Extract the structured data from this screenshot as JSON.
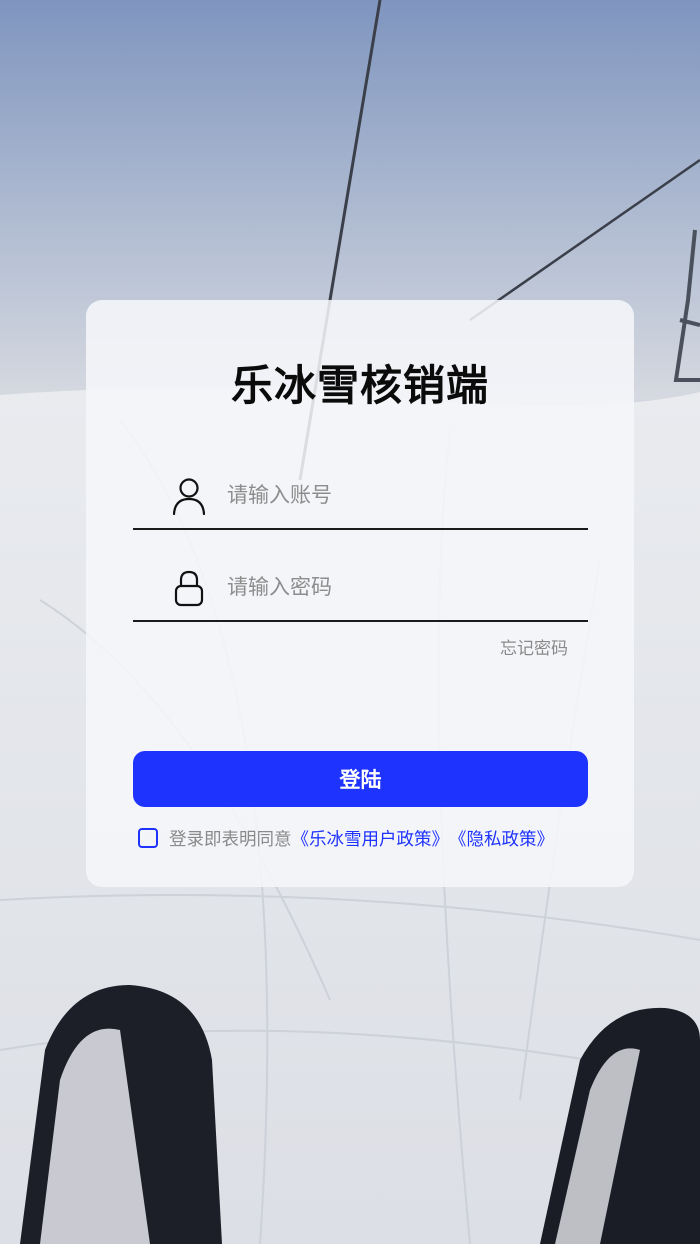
{
  "app": {
    "title": "乐冰雪核销端"
  },
  "form": {
    "account_placeholder": "请输入账号",
    "password_placeholder": "请输入密码",
    "forgot_label": "忘记密码",
    "login_label": "登陆"
  },
  "agreement": {
    "checked": false,
    "prefix": "登录即表明同意",
    "user_policy": "《乐冰雪用户政策》",
    "privacy_policy": "《隐私政策》"
  },
  "colors": {
    "accent": "#1f33ff",
    "placeholder": "#8d8d8d"
  },
  "icons": {
    "account": "user-icon",
    "password": "lock-icon"
  }
}
